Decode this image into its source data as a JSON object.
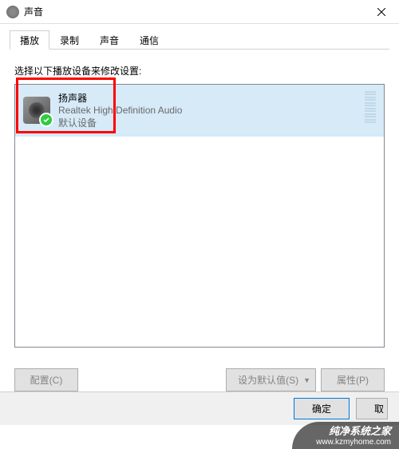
{
  "window": {
    "title": "声音"
  },
  "tabs": {
    "playback": "播放",
    "recording": "录制",
    "sounds": "声音",
    "communications": "通信"
  },
  "instruction": "选择以下播放设备来修改设置:",
  "device": {
    "name": "扬声器",
    "driver": "Realtek High Definition Audio",
    "status": "默认设备"
  },
  "buttons": {
    "configure": "配置(C)",
    "setDefault": "设为默认值(S)",
    "properties": "属性(P)",
    "ok": "确定",
    "cancel": "取"
  },
  "watermark": {
    "title": "纯净系统之家",
    "url": "www.kzmyhome.com"
  }
}
